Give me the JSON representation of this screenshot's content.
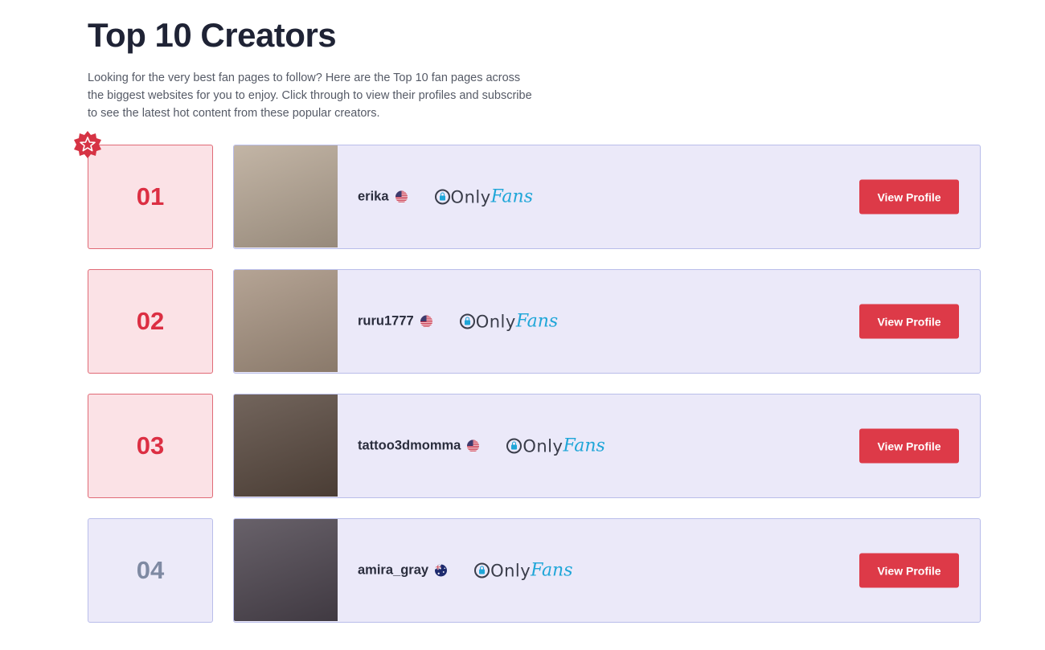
{
  "page": {
    "title": "Top 10 Creators",
    "intro": "Looking for the very best fan pages to follow? Here are the Top 10 fan pages across the biggest websites for you to enjoy. Click through to view their profiles and subscribe to see the latest hot content from these popular creators."
  },
  "colors": {
    "accent": "#dd3a48",
    "rank_top": "#dc2f43",
    "rank_plain": "#7f8aa3",
    "card_bg": "#ebe9f9",
    "platform_blue": "#1fa6d8"
  },
  "creators": [
    {
      "rank": "01",
      "name": "erika",
      "country": "US",
      "flag_icon": "us-flag-icon",
      "platform_only": "Only",
      "platform_fans": "Fans",
      "button": "View Profile",
      "featured": true,
      "photo_tone": "#b8a896"
    },
    {
      "rank": "02",
      "name": "ruru1777",
      "country": "US",
      "flag_icon": "us-flag-icon",
      "platform_only": "Only",
      "platform_fans": "Fans",
      "button": "View Profile",
      "featured": false,
      "photo_tone": "#a89482"
    },
    {
      "rank": "03",
      "name": "tattoo3dmomma",
      "country": "US",
      "flag_icon": "us-flag-icon",
      "platform_only": "Only",
      "platform_fans": "Fans",
      "button": "View Profile",
      "featured": false,
      "photo_tone": "#5a4a40"
    },
    {
      "rank": "04",
      "name": "amira_gray",
      "country": "AU",
      "flag_icon": "au-flag-icon",
      "platform_only": "Only",
      "platform_fans": "Fans",
      "button": "View Profile",
      "featured": false,
      "photo_tone": "#4e4650"
    }
  ]
}
